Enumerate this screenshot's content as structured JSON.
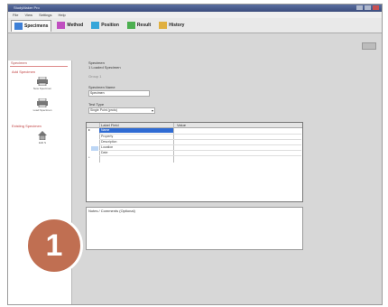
{
  "window": {
    "title": "StudyMaker Pro"
  },
  "menu": [
    "File",
    "View",
    "Settings",
    "Help"
  ],
  "tabs": [
    {
      "label": "Specimens",
      "icon": "specimen-icon",
      "color": "#3d7fd6",
      "active": true
    },
    {
      "label": "Method",
      "icon": "method-icon",
      "color": "#c04fc0",
      "active": false
    },
    {
      "label": "Position",
      "icon": "position-icon",
      "color": "#35a6d9",
      "active": false
    },
    {
      "label": "Result",
      "icon": "result-icon",
      "color": "#4caf50",
      "active": false
    },
    {
      "label": "History",
      "icon": "history-icon",
      "color": "#e0b040",
      "active": false
    }
  ],
  "sidebar": {
    "header": "Specimen",
    "section_add": "Add Specimen",
    "items": [
      {
        "label": "New Specimen",
        "icon": "printer-icon"
      },
      {
        "label": "Load Specimen",
        "icon": "printer-icon"
      }
    ],
    "section_existing": "Existing Specimen",
    "existing_items": [
      {
        "label": "Edit S",
        "icon": "house-icon"
      }
    ]
  },
  "form": {
    "specimen_label": "Specimen",
    "specimen_value": "1 Loaded Specimen",
    "group_value": "Group 1",
    "name_label": "Specimen Name",
    "name_value": "Specimen",
    "test_type_label": "Test Type",
    "test_type_value": "Single Point (proto)"
  },
  "grid": {
    "headers": [
      "Label Field",
      "Value"
    ],
    "rows": [
      "Name",
      "Property",
      "Description",
      "Location",
      "Date"
    ],
    "selected_row": 0
  },
  "notes": {
    "label": "Notes / Comments (Optional)"
  },
  "badge": {
    "number": "1",
    "color": "#c06f52"
  }
}
